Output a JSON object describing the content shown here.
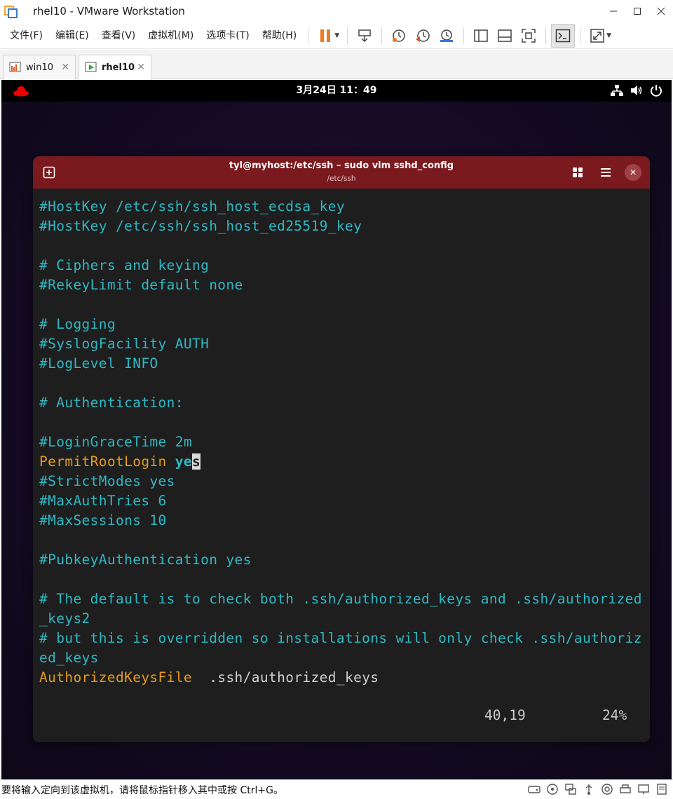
{
  "window": {
    "title": "rhel10 - VMware Workstation"
  },
  "menu": [
    "文件(F)",
    "编辑(E)",
    "查看(V)",
    "虚拟机(M)",
    "选项卡(T)",
    "帮助(H)"
  ],
  "tabs": [
    {
      "label": "win10",
      "close": "✕"
    },
    {
      "label": "rhel10",
      "close": "✕"
    }
  ],
  "gnome": {
    "clock": "3月24日 11：49"
  },
  "terminal": {
    "title": "tyl@myhost:/etc/ssh – sudo vim sshd_config",
    "subtitle": "/etc/ssh",
    "close": "✕",
    "lines": {
      "l01": "#HostKey /etc/ssh/ssh_host_ecdsa_key",
      "l02": "#HostKey /etc/ssh/ssh_host_ed25519_key",
      "l04": "# Ciphers and keying",
      "l05": "#RekeyLimit default none",
      "l07": "# Logging",
      "l08": "#SyslogFacility AUTH",
      "l09": "#LogLevel INFO",
      "l11": "# Authentication:",
      "l13": "#LoginGraceTime 2m",
      "l14_key": "PermitRootLogin",
      "l14_val": "ye",
      "l14_cursor": "s",
      "l15": "#StrictModes yes",
      "l16": "#MaxAuthTries 6",
      "l17": "#MaxSessions 10",
      "l19": "#PubkeyAuthentication yes",
      "l21": "# The default is to check both .ssh/authorized_keys and .ssh/authorized",
      "l22": "_keys2",
      "l23": "# but this is overridden so installations will only check .ssh/authoriz",
      "l24": "ed_keys",
      "l25_key": "AuthorizedKeysFile",
      "l25_val": ".ssh/authorized_keys"
    },
    "status": {
      "position": "40,19",
      "percent": "24%"
    }
  },
  "statusbar": {
    "message": "要将输入定向到该虚拟机，请将鼠标指针移入其中或按 Ctrl+G。"
  }
}
